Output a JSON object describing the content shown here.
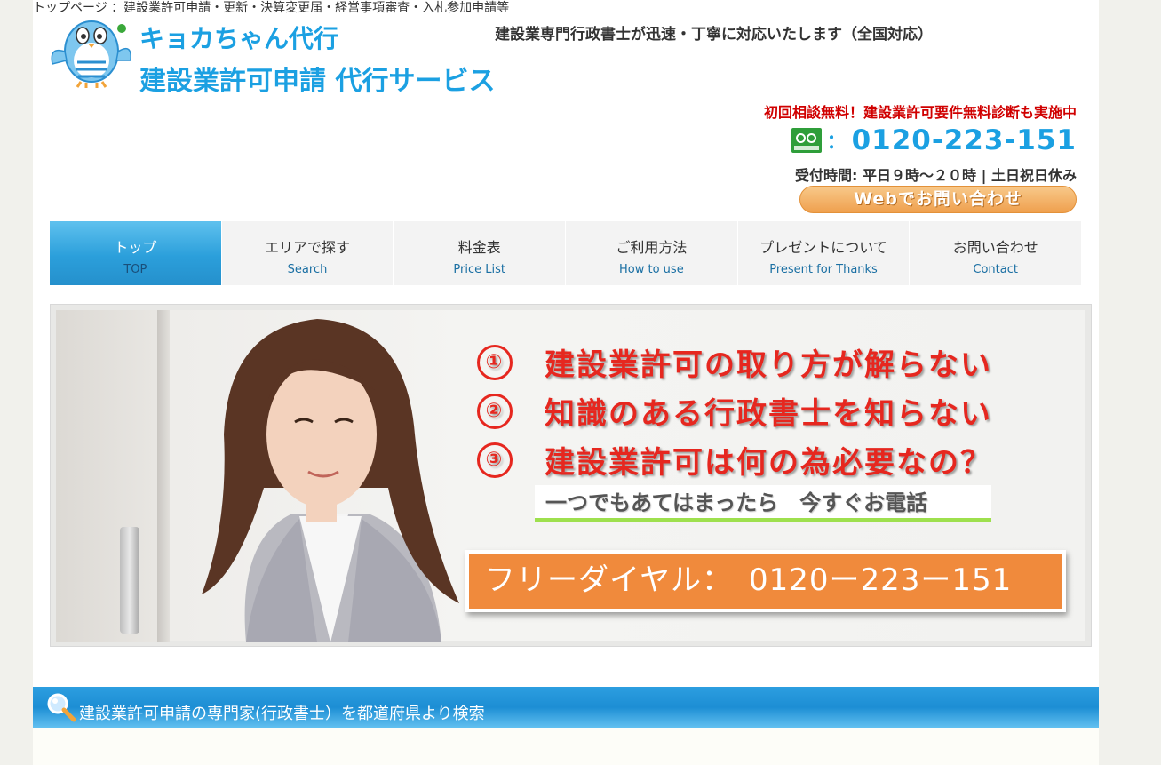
{
  "topline": "トップページ ：建設業許可申請・更新・決算変更届・経営事項審査・入札参加申請等",
  "header": {
    "brand_line1": "キョカちゃん代行",
    "brand_line2": "建設業許可申請 代行サービス",
    "tagline": "建設業専門行政書士が迅速・丁寧に対応いたします（全国対応）",
    "promo": "初回相談無料！建設業許可要件無料診断も実施中",
    "phone_colon": "：",
    "phone_number": "0120-223-151",
    "hours": "受付時間: 平日９時～２０時 | 土日祝日休み",
    "web_button": "Webでお問い合わせ"
  },
  "nav": {
    "items": [
      {
        "jp": "トップ",
        "en": "TOP"
      },
      {
        "jp": "エリアで探す",
        "en": "Search"
      },
      {
        "jp": "料金表",
        "en": "Price List"
      },
      {
        "jp": "ご利用方法",
        "en": "How to use"
      },
      {
        "jp": "プレゼントについて",
        "en": "Present for Thanks"
      },
      {
        "jp": "お問い合わせ",
        "en": "Contact"
      }
    ]
  },
  "hero": {
    "points": [
      {
        "num": "①",
        "text": "建設業許可の取り方が解らない"
      },
      {
        "num": "②",
        "text": "知識のある行政書士を知らない"
      },
      {
        "num": "③",
        "text": "建設業許可は何の為必要なの？"
      }
    ],
    "callout": "一つでもあてはまったら　今すぐお電話",
    "freedial": "フリーダイヤル：　0120ー223ー151"
  },
  "section": {
    "title": "建設業許可申請の専門家(行政書士）を都道府県より検索"
  },
  "colors": {
    "brand_blue": "#1ba0e2",
    "promo_red": "#d00000",
    "nav_active": "#2b9fdb",
    "banner_orange": "#f08a3c"
  },
  "icons": {
    "mascot": "bird-mascot-icon",
    "freedial": "freedial-icon",
    "search": "magnifier-icon"
  }
}
